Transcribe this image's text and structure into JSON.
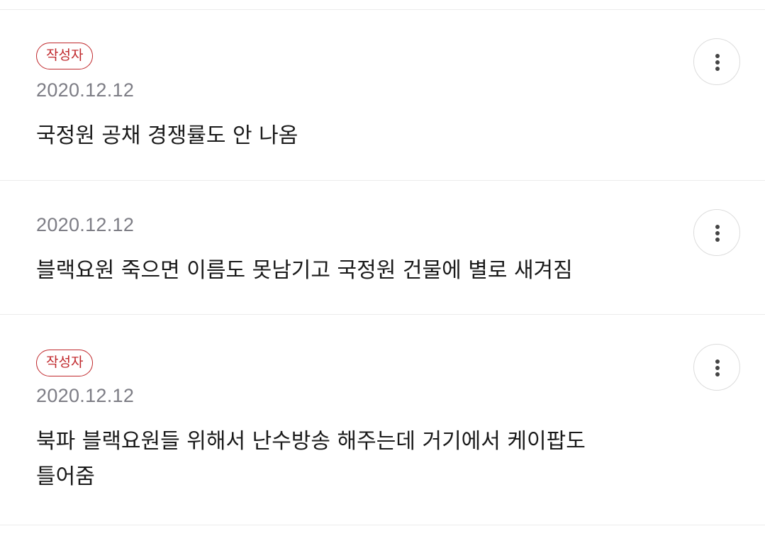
{
  "comments": [
    {
      "author_badge": "작성자",
      "date": "2020.12.12",
      "text": "국정원 공채 경쟁률도 안 나옴",
      "more_icon": "more-vertical-icon"
    },
    {
      "date": "2020.12.12",
      "text": "블랙요원 죽으면 이름도 못남기고 국정원 건물에 별로 새겨짐",
      "more_icon": "more-vertical-icon"
    },
    {
      "author_badge": "작성자",
      "date": "2020.12.12",
      "text_lines": [
        "북파 블랙요원들 위해서 난수방송 해주는데 거기에서 케이팝도",
        "틀어줌"
      ],
      "more_icon": "more-vertical-icon"
    }
  ],
  "colors": {
    "badge": "#c0282c",
    "date": "#7d7d85",
    "text": "#1a1a1a",
    "divider": "#ececec"
  }
}
